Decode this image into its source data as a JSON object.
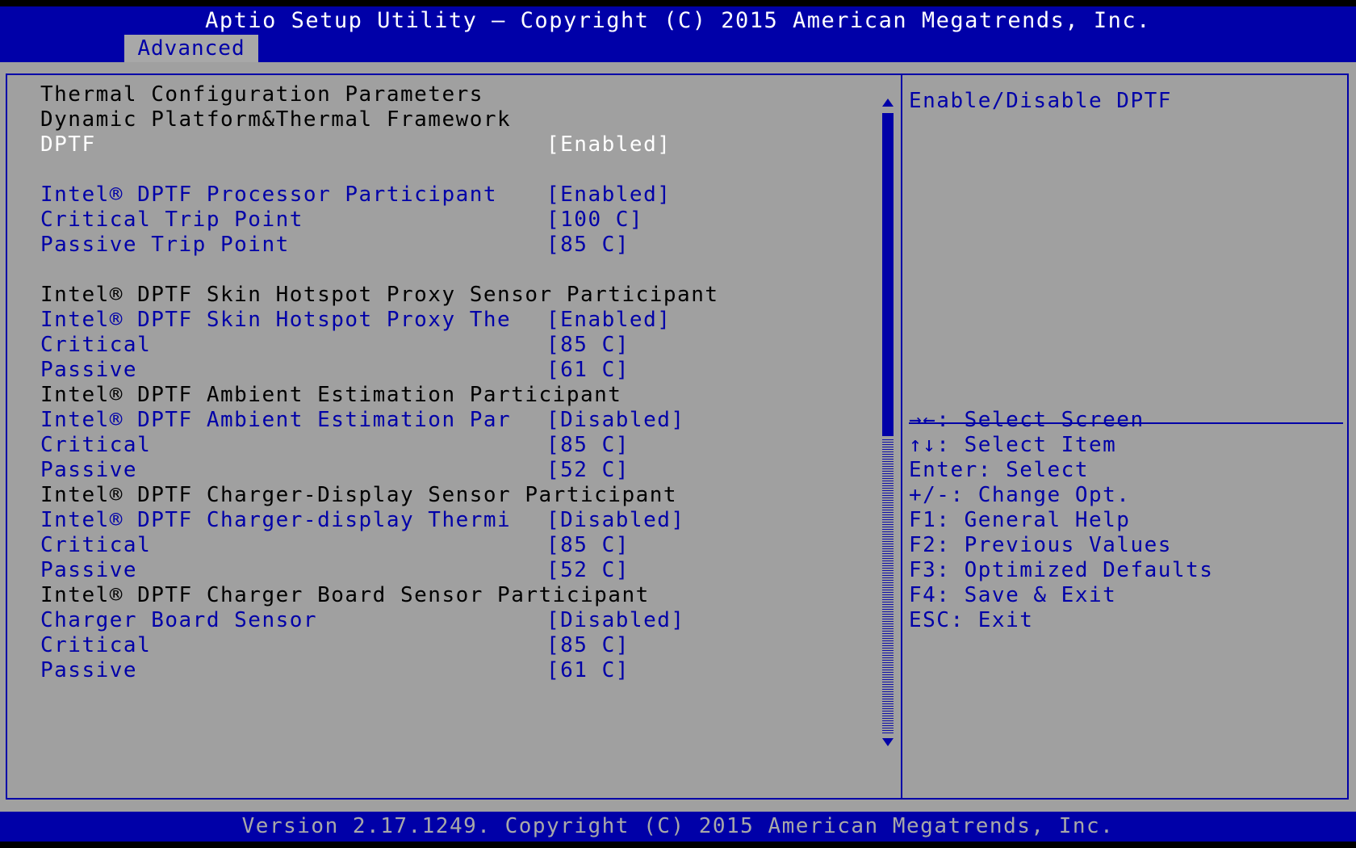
{
  "header": {
    "title": "Aptio Setup Utility – Copyright (C) 2015 American Megatrends, Inc.",
    "tab": "Advanced"
  },
  "colors": {
    "bios_blue": "#0000a8",
    "background_gray": "#a0a0a0",
    "text_white": "#ffffff",
    "text_black": "#000000"
  },
  "settings": {
    "section_title": "Thermal Configuration Parameters",
    "dptf_heading": "Dynamic Platform&Thermal Framework",
    "dptf": {
      "label": "DPTF",
      "value": "[Enabled]"
    },
    "processor_participant": {
      "label": "Intel® DPTF Processor Participant",
      "value": "[Enabled]"
    },
    "critical_trip_point": {
      "label": "Critical Trip Point",
      "value": "[100 C]"
    },
    "passive_trip_point": {
      "label": "Passive Trip Point",
      "value": "[85 C]"
    },
    "skin_heading": "Intel® DPTF Skin Hotspot Proxy Sensor Participant",
    "skin_sensor": {
      "label": "Intel® DPTF Skin Hotspot Proxy The",
      "value": "[Enabled]"
    },
    "skin_critical": {
      "label": "Critical",
      "value": "[85 C]"
    },
    "skin_passive": {
      "label": "Passive",
      "value": "[61 C]"
    },
    "ambient_heading": "Intel® DPTF Ambient Estimation Participant",
    "ambient_participant": {
      "label": "Intel® DPTF Ambient Estimation Par",
      "value": "[Disabled]"
    },
    "ambient_critical": {
      "label": "Critical",
      "value": "[85 C]"
    },
    "ambient_passive": {
      "label": "Passive",
      "value": "[52 C]"
    },
    "charger_display_heading": "Intel® DPTF Charger-Display Sensor Participant",
    "charger_display_thermistor": {
      "label": "Intel® DPTF Charger-display Thermi",
      "value": "[Disabled]"
    },
    "charger_display_critical": {
      "label": "Critical",
      "value": "[85 C]"
    },
    "charger_display_passive": {
      "label": "Passive",
      "value": "[52 C]"
    },
    "charger_board_heading": "Intel® DPTF Charger Board Sensor Participant",
    "charger_board_sensor": {
      "label": "Charger Board Sensor",
      "value": "[Disabled]"
    },
    "charger_board_critical": {
      "label": "Critical",
      "value": "[85 C]"
    },
    "charger_board_passive": {
      "label": "Passive",
      "value": "[61 C]"
    }
  },
  "help": {
    "description": "Enable/Disable DPTF",
    "keys": [
      "→←: Select Screen",
      "↑↓: Select Item",
      "Enter: Select",
      "+/-: Change Opt.",
      "F1: General Help",
      "F2: Previous Values",
      "F3: Optimized Defaults",
      "F4: Save & Exit",
      "ESC: Exit"
    ]
  },
  "footer": {
    "text": "Version 2.17.1249. Copyright (C) 2015 American Megatrends, Inc."
  },
  "scrollbar": {
    "visible_fraction": 0.5
  },
  "icons": {
    "scroll_up": "triangle-up-icon",
    "scroll_down": "triangle-down-icon"
  }
}
